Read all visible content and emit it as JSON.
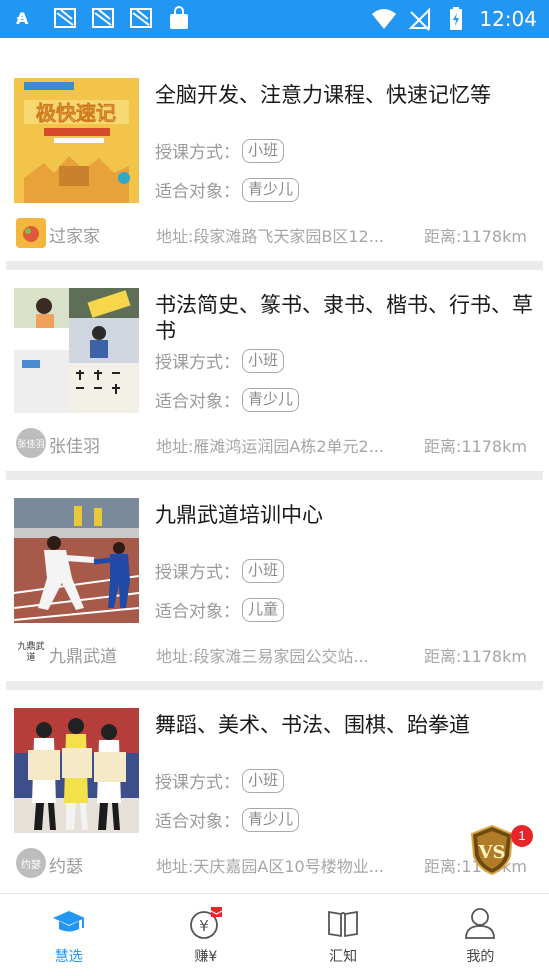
{
  "status_bar": {
    "time": "12:04"
  },
  "items": [
    {
      "title": "全脑开发、注意力课程、快速记忆等",
      "mode_label": "授课方式：",
      "mode": "小班",
      "target_label": "适合对象：",
      "target": "青少儿",
      "org": "过家家",
      "address": "地址:段家滩路飞天家园B区12...",
      "distance": "距离:1178km",
      "thumb_text": "极快速记"
    },
    {
      "title": "书法简史、篆书、隶书、楷书、行书、草书",
      "mode_label": "授课方式：",
      "mode": "小班",
      "target_label": "适合对象：",
      "target": "青少儿",
      "org": "张佳羽",
      "avatar_text": "张佳羽",
      "address": "地址:雁滩鸿运润园A栋2单元2...",
      "distance": "距离:1178km"
    },
    {
      "title": "九鼎武道培训中心",
      "mode_label": "授课方式：",
      "mode": "小班",
      "target_label": "适合对象：",
      "target": "儿童",
      "org": "九鼎武道",
      "avatar_text": "九鼎武道",
      "address": "地址:段家滩三易家园公交站...",
      "distance": "距离:1178km"
    },
    {
      "title": "舞蹈、美术、书法、围棋、跆拳道",
      "mode_label": "授课方式：",
      "mode": "小班",
      "target_label": "适合对象：",
      "target": "青少儿",
      "org": "约瑟",
      "avatar_text": "约瑟",
      "address": "地址:天庆嘉园A区10号楼物业...",
      "distance": "距离:1178km"
    }
  ],
  "floating_badge": {
    "count": "1"
  },
  "bottom_nav": [
    {
      "label": "慧选",
      "icon": "graduation-cap-icon",
      "active": true
    },
    {
      "label": "赚¥",
      "icon": "money-bag-icon"
    },
    {
      "label": "汇知",
      "icon": "open-book-icon"
    },
    {
      "label": "我的",
      "icon": "user-icon"
    }
  ],
  "colors": {
    "accent": "#2196f3",
    "badge": "#e8262a"
  }
}
